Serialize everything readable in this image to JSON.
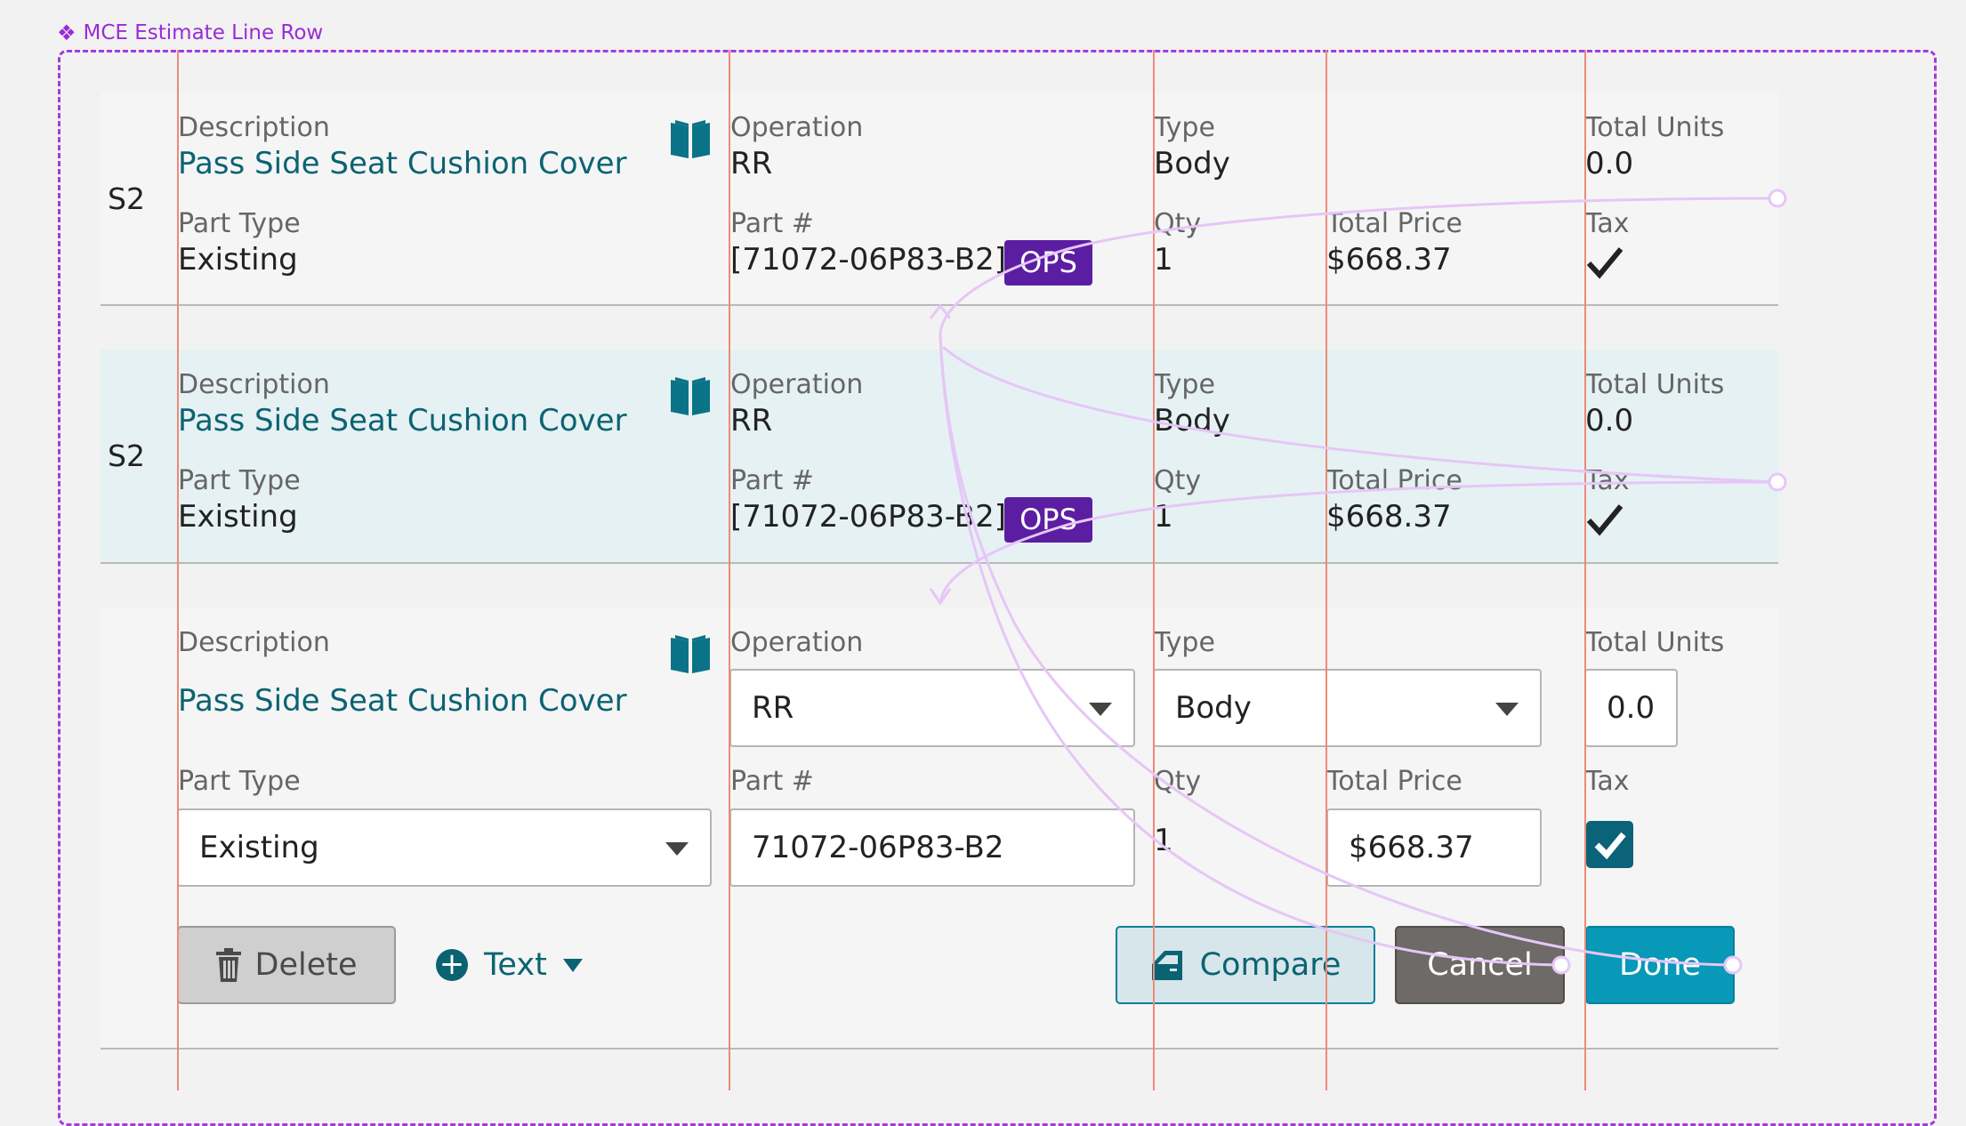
{
  "frame": {
    "label": "MCE Estimate Line Row",
    "label_color": "#9b2bd8"
  },
  "colors": {
    "accent": "#0b6372",
    "ops_badge": "#5b1ea3",
    "done": "#0898b8",
    "cancel": "#6d6a67",
    "selected_row": "#e6f1f3",
    "prototype_connector": "#e6c6f7",
    "layout_guide": "#ee8a78"
  },
  "rows": [
    {
      "seq": "S2",
      "description_label": "Description",
      "description": "Pass Side Seat Cushion Cover",
      "operation_label": "Operation",
      "operation": "RR",
      "type_label": "Type",
      "type": "Body",
      "total_units_label": "Total Units",
      "total_units": "0.0",
      "part_type_label": "Part Type",
      "part_type": "Existing",
      "part_no_label": "Part #",
      "part_no": "[71072-06P83-B2]",
      "badge": "OPS",
      "qty_label": "Qty",
      "qty": "1",
      "total_price_label": "Total Price",
      "total_price": "$668.37",
      "tax_label": "Tax",
      "tax": true
    },
    {
      "seq": "S2",
      "description_label": "Description",
      "description": "Pass Side Seat Cushion Cover",
      "operation_label": "Operation",
      "operation": "RR",
      "type_label": "Type",
      "type": "Body",
      "total_units_label": "Total Units",
      "total_units": "0.0",
      "part_type_label": "Part Type",
      "part_type": "Existing",
      "part_no_label": "Part #",
      "part_no": "[71072-06P83-B2]",
      "badge": "OPS",
      "qty_label": "Qty",
      "qty": "1",
      "total_price_label": "Total Price",
      "total_price": "$668.37",
      "tax_label": "Tax",
      "tax": true
    }
  ],
  "edit_row": {
    "description_label": "Description",
    "description": "Pass Side Seat Cushion Cover",
    "operation_label": "Operation",
    "operation_value": "RR",
    "type_label": "Type",
    "type_value": "Body",
    "total_units_label": "Total Units",
    "total_units_value": "0.0",
    "part_type_label": "Part Type",
    "part_type_value": "Existing",
    "part_no_label": "Part #",
    "part_no_value": "71072-06P83-B2",
    "qty_label": "Qty",
    "qty_value": "1",
    "total_price_label": "Total Price",
    "total_price_value": "$668.37",
    "tax_label": "Tax",
    "tax_checked": true,
    "actions": {
      "delete": "Delete",
      "text": "Text",
      "compare": "Compare",
      "cancel": "Cancel",
      "done": "Done"
    }
  }
}
